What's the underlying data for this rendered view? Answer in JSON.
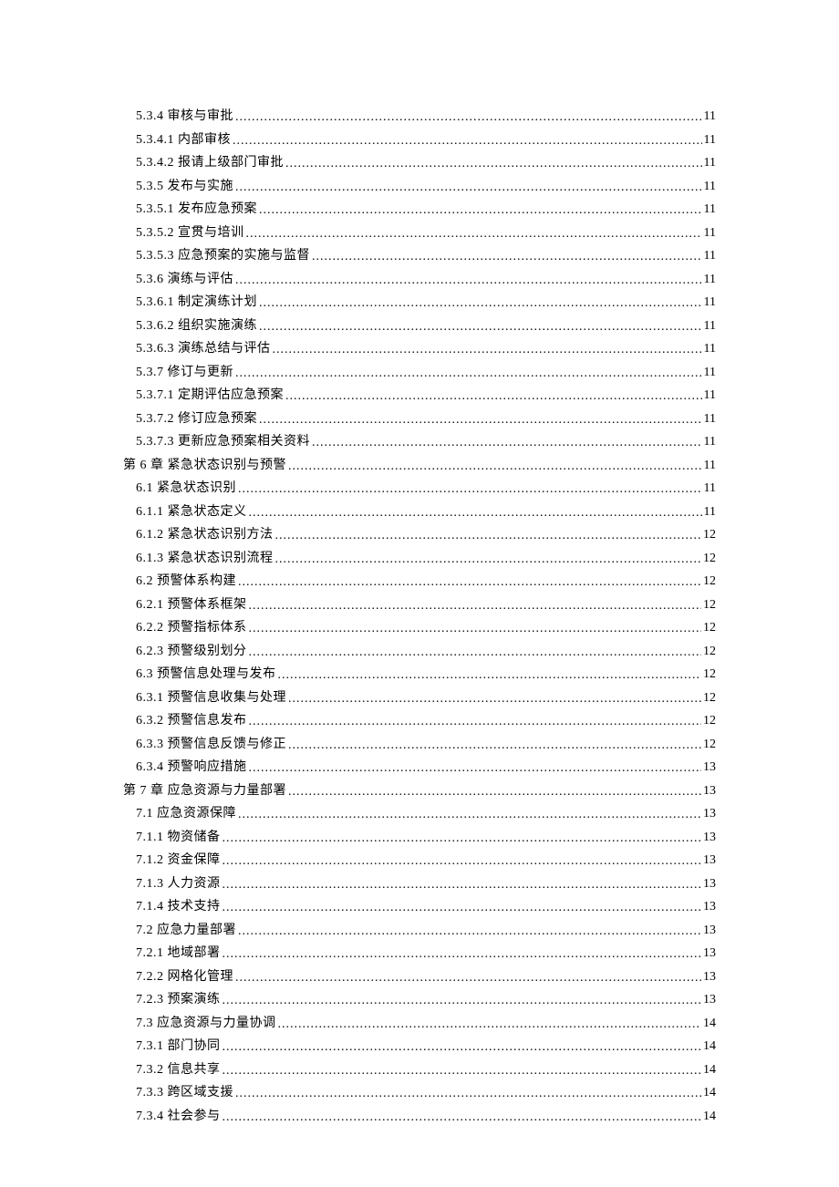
{
  "toc": [
    {
      "level": 1,
      "title": "5.3.4 审核与审批",
      "page": "11"
    },
    {
      "level": 1,
      "title": "5.3.4.1 内部审核",
      "page": "11"
    },
    {
      "level": 1,
      "title": "5.3.4.2 报请上级部门审批",
      "page": "11"
    },
    {
      "level": 1,
      "title": "5.3.5 发布与实施",
      "page": "11"
    },
    {
      "level": 1,
      "title": "5.3.5.1 发布应急预案",
      "page": "11"
    },
    {
      "level": 1,
      "title": "5.3.5.2 宣贯与培训",
      "page": "11"
    },
    {
      "level": 1,
      "title": "5.3.5.3 应急预案的实施与监督",
      "page": "11"
    },
    {
      "level": 1,
      "title": "5.3.6 演练与评估",
      "page": "11"
    },
    {
      "level": 1,
      "title": "5.3.6.1 制定演练计划",
      "page": "11"
    },
    {
      "level": 1,
      "title": "5.3.6.2 组织实施演练",
      "page": "11"
    },
    {
      "level": 1,
      "title": "5.3.6.3 演练总结与评估",
      "page": "11"
    },
    {
      "level": 1,
      "title": "5.3.7 修订与更新",
      "page": "11"
    },
    {
      "level": 1,
      "title": "5.3.7.1 定期评估应急预案",
      "page": "11"
    },
    {
      "level": 1,
      "title": "5.3.7.2 修订应急预案",
      "page": "11"
    },
    {
      "level": 1,
      "title": "5.3.7.3 更新应急预案相关资料",
      "page": "11"
    },
    {
      "level": 0,
      "title": "第 6 章 紧急状态识别与预警",
      "page": "11"
    },
    {
      "level": 1,
      "title": "6.1 紧急状态识别",
      "page": "11"
    },
    {
      "level": 1,
      "title": "6.1.1 紧急状态定义",
      "page": "11"
    },
    {
      "level": 1,
      "title": "6.1.2 紧急状态识别方法",
      "page": "12"
    },
    {
      "level": 1,
      "title": "6.1.3 紧急状态识别流程",
      "page": "12"
    },
    {
      "level": 1,
      "title": "6.2 预警体系构建",
      "page": "12"
    },
    {
      "level": 1,
      "title": "6.2.1 预警体系框架",
      "page": "12"
    },
    {
      "level": 1,
      "title": "6.2.2 预警指标体系",
      "page": "12"
    },
    {
      "level": 1,
      "title": "6.2.3 预警级别划分",
      "page": "12"
    },
    {
      "level": 1,
      "title": "6.3 预警信息处理与发布",
      "page": "12"
    },
    {
      "level": 1,
      "title": "6.3.1 预警信息收集与处理",
      "page": "12"
    },
    {
      "level": 1,
      "title": "6.3.2 预警信息发布",
      "page": "12"
    },
    {
      "level": 1,
      "title": "6.3.3 预警信息反馈与修正",
      "page": "12"
    },
    {
      "level": 1,
      "title": "6.3.4 预警响应措施",
      "page": "13"
    },
    {
      "level": 0,
      "title": "第 7 章 应急资源与力量部署",
      "page": "13"
    },
    {
      "level": 1,
      "title": "7.1 应急资源保障",
      "page": "13"
    },
    {
      "level": 1,
      "title": "7.1.1 物资储备 ",
      "page": "13"
    },
    {
      "level": 1,
      "title": "7.1.2 资金保障 ",
      "page": "13"
    },
    {
      "level": 1,
      "title": "7.1.3 人力资源 ",
      "page": "13"
    },
    {
      "level": 1,
      "title": "7.1.4 技术支持 ",
      "page": "13"
    },
    {
      "level": 1,
      "title": "7.2 应急力量部署",
      "page": "13"
    },
    {
      "level": 1,
      "title": "7.2.1 地域部署 ",
      "page": "13"
    },
    {
      "level": 1,
      "title": "7.2.2 网格化管理",
      "page": "13"
    },
    {
      "level": 1,
      "title": "7.2.3 预案演练 ",
      "page": "13"
    },
    {
      "level": 1,
      "title": "7.3 应急资源与力量协调",
      "page": "14"
    },
    {
      "level": 1,
      "title": "7.3.1 部门协同 ",
      "page": "14"
    },
    {
      "level": 1,
      "title": "7.3.2 信息共享 ",
      "page": "14"
    },
    {
      "level": 1,
      "title": "7.3.3 跨区域支援",
      "page": "14"
    },
    {
      "level": 1,
      "title": "7.3.4 社会参与 ",
      "page": "14"
    }
  ]
}
